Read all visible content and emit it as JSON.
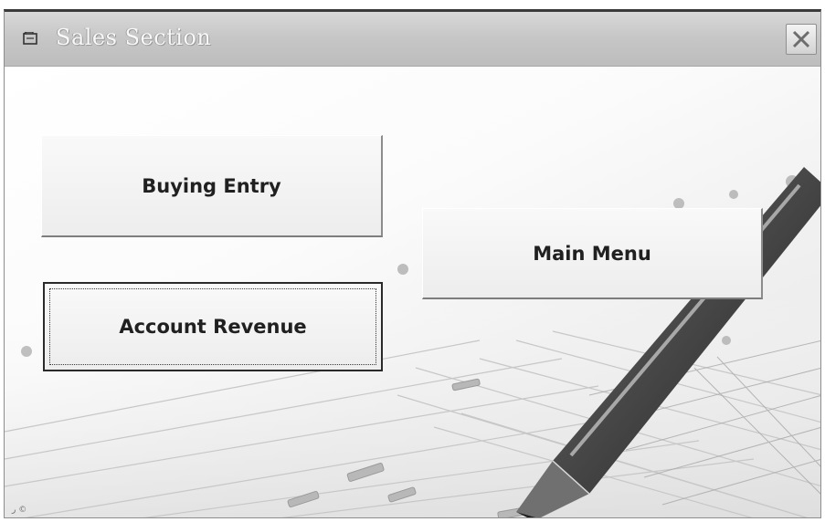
{
  "window": {
    "title": "Sales Section",
    "icon": "window-icon",
    "close_icon": "close-icon"
  },
  "buttons": {
    "buying_entry": "Buying Entry",
    "account_revenue": "Account Revenue",
    "main_menu": "Main Menu"
  },
  "footer": {
    "corner_text": "ر ©"
  },
  "colors": {
    "titlebar": "#c8c8c8",
    "title_text": "#f8f8f8",
    "button_face": "#f3f3f3",
    "button_text": "#202020",
    "background": "#f7f7f7"
  }
}
